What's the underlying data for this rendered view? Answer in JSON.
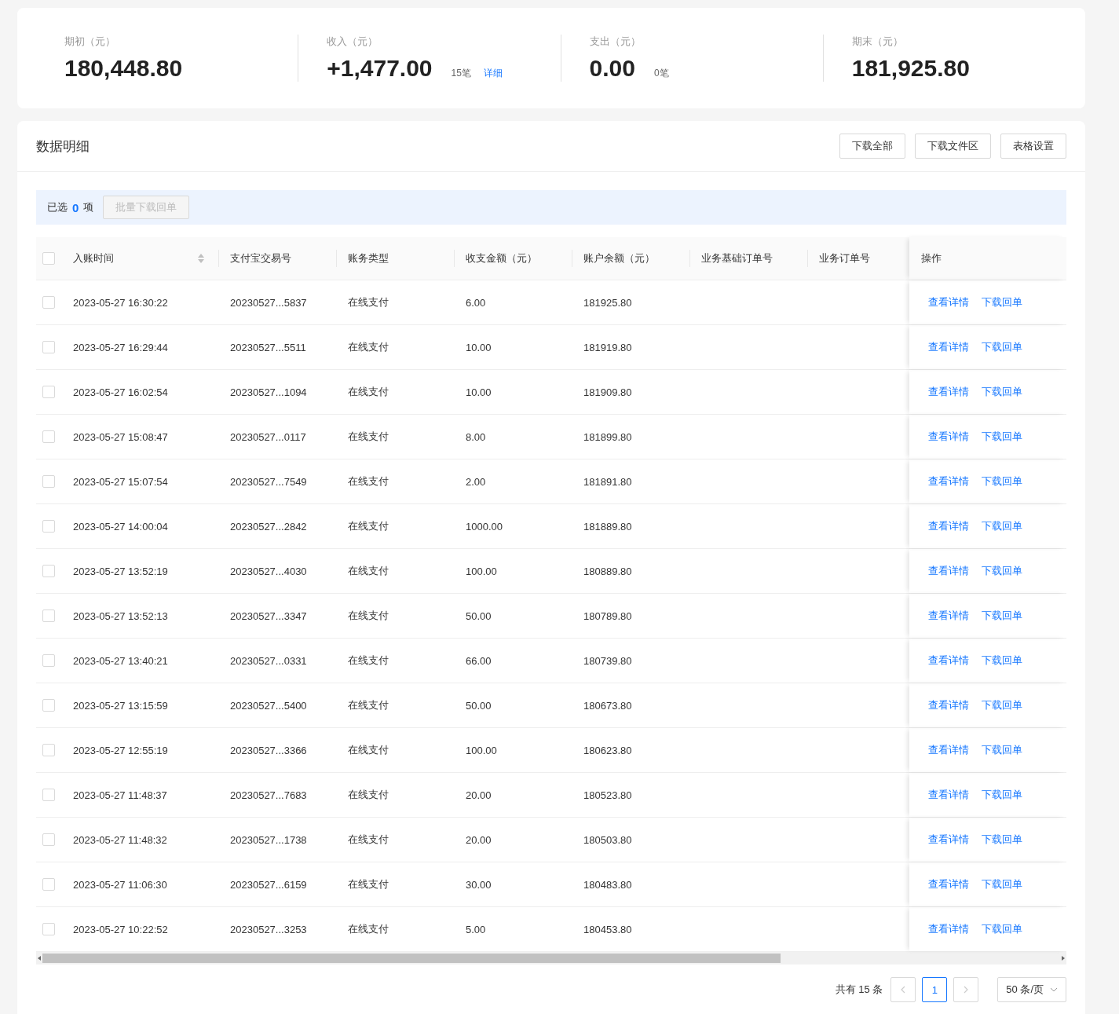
{
  "summary": [
    {
      "label": "期初（元）",
      "value": "180,448.80"
    },
    {
      "label": "收入（元）",
      "value": "+1,477.00",
      "count": "15笔",
      "link": "详细"
    },
    {
      "label": "支出（元）",
      "value": "0.00",
      "count": "0笔"
    },
    {
      "label": "期末（元）",
      "value": "181,925.80"
    }
  ],
  "detail": {
    "title": "数据明细",
    "buttons": [
      "下载全部",
      "下载文件区",
      "表格设置"
    ]
  },
  "selection": {
    "prefix": "已选",
    "count": "0",
    "suffix": "项",
    "batch_button": {
      "label": "批量下载回单",
      "disabled": true
    }
  },
  "table": {
    "all_checked": false,
    "columns": [
      {
        "label": "入账时间",
        "sortable": true
      },
      {
        "label": "支付宝交易号",
        "sortable": false
      },
      {
        "label": "账务类型",
        "sortable": false
      },
      {
        "label": "收支金额（元）",
        "sortable": false
      },
      {
        "label": "账户余额（元）",
        "sortable": false
      },
      {
        "label": "业务基础订单号",
        "sortable": false
      },
      {
        "label": "业务订单号",
        "sortable": false
      },
      {
        "label": "操作",
        "sortable": false
      }
    ],
    "rows": [
      {
        "checked": false,
        "time": "2023-05-27 16:30:22",
        "trade_no": "20230527...5837",
        "type": "在线支付",
        "amount": "6.00",
        "balance": "181925.80",
        "actions": [
          "查看详情",
          "下载回单"
        ]
      },
      {
        "checked": false,
        "time": "2023-05-27 16:29:44",
        "trade_no": "20230527...5511",
        "type": "在线支付",
        "amount": "10.00",
        "balance": "181919.80",
        "actions": [
          "查看详情",
          "下载回单"
        ]
      },
      {
        "checked": false,
        "time": "2023-05-27 16:02:54",
        "trade_no": "20230527...1094",
        "type": "在线支付",
        "amount": "10.00",
        "balance": "181909.80",
        "actions": [
          "查看详情",
          "下载回单"
        ]
      },
      {
        "checked": false,
        "time": "2023-05-27 15:08:47",
        "trade_no": "20230527...0117",
        "type": "在线支付",
        "amount": "8.00",
        "balance": "181899.80",
        "actions": [
          "查看详情",
          "下载回单"
        ]
      },
      {
        "checked": false,
        "time": "2023-05-27 15:07:54",
        "trade_no": "20230527...7549",
        "type": "在线支付",
        "amount": "2.00",
        "balance": "181891.80",
        "actions": [
          "查看详情",
          "下载回单"
        ]
      },
      {
        "checked": false,
        "time": "2023-05-27 14:00:04",
        "trade_no": "20230527...2842",
        "type": "在线支付",
        "amount": "1000.00",
        "balance": "181889.80",
        "actions": [
          "查看详情",
          "下载回单"
        ]
      },
      {
        "checked": false,
        "time": "2023-05-27 13:52:19",
        "trade_no": "20230527...4030",
        "type": "在线支付",
        "amount": "100.00",
        "balance": "180889.80",
        "actions": [
          "查看详情",
          "下载回单"
        ]
      },
      {
        "checked": false,
        "time": "2023-05-27 13:52:13",
        "trade_no": "20230527...3347",
        "type": "在线支付",
        "amount": "50.00",
        "balance": "180789.80",
        "actions": [
          "查看详情",
          "下载回单"
        ]
      },
      {
        "checked": false,
        "time": "2023-05-27 13:40:21",
        "trade_no": "20230527...0331",
        "type": "在线支付",
        "amount": "66.00",
        "balance": "180739.80",
        "actions": [
          "查看详情",
          "下载回单"
        ]
      },
      {
        "checked": false,
        "time": "2023-05-27 13:15:59",
        "trade_no": "20230527...5400",
        "type": "在线支付",
        "amount": "50.00",
        "balance": "180673.80",
        "actions": [
          "查看详情",
          "下载回单"
        ]
      },
      {
        "checked": false,
        "time": "2023-05-27 12:55:19",
        "trade_no": "20230527...3366",
        "type": "在线支付",
        "amount": "100.00",
        "balance": "180623.80",
        "actions": [
          "查看详情",
          "下载回单"
        ]
      },
      {
        "checked": false,
        "time": "2023-05-27 11:48:37",
        "trade_no": "20230527...7683",
        "type": "在线支付",
        "amount": "20.00",
        "balance": "180523.80",
        "actions": [
          "查看详情",
          "下载回单"
        ]
      },
      {
        "checked": false,
        "time": "2023-05-27 11:48:32",
        "trade_no": "20230527...1738",
        "type": "在线支付",
        "amount": "20.00",
        "balance": "180503.80",
        "actions": [
          "查看详情",
          "下载回单"
        ]
      },
      {
        "checked": false,
        "time": "2023-05-27 11:06:30",
        "trade_no": "20230527...6159",
        "type": "在线支付",
        "amount": "30.00",
        "balance": "180483.80",
        "actions": [
          "查看详情",
          "下载回单"
        ]
      },
      {
        "checked": false,
        "time": "2023-05-27 10:22:52",
        "trade_no": "20230527...3253",
        "type": "在线支付",
        "amount": "5.00",
        "balance": "180453.80",
        "actions": [
          "查看详情",
          "下载回单"
        ]
      }
    ]
  },
  "pagination": {
    "total": "共有 15 条",
    "prev_disabled": true,
    "next_disabled": true,
    "pages": [
      {
        "label": "1",
        "selected": true
      }
    ],
    "page_size": "50 条/页"
  }
}
